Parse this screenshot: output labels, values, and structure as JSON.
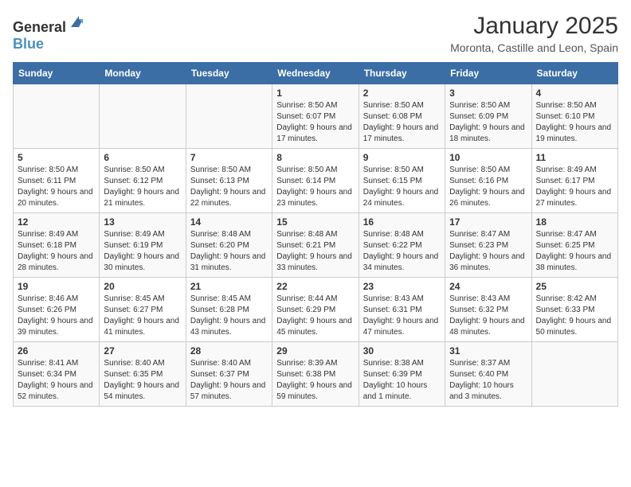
{
  "header": {
    "logo_general": "General",
    "logo_blue": "Blue",
    "month_year": "January 2025",
    "location": "Moronta, Castille and Leon, Spain"
  },
  "days_of_week": [
    "Sunday",
    "Monday",
    "Tuesday",
    "Wednesday",
    "Thursday",
    "Friday",
    "Saturday"
  ],
  "weeks": [
    [
      {
        "day": "",
        "info": ""
      },
      {
        "day": "",
        "info": ""
      },
      {
        "day": "",
        "info": ""
      },
      {
        "day": "1",
        "info": "Sunrise: 8:50 AM\nSunset: 6:07 PM\nDaylight: 9 hours and 17 minutes."
      },
      {
        "day": "2",
        "info": "Sunrise: 8:50 AM\nSunset: 6:08 PM\nDaylight: 9 hours and 17 minutes."
      },
      {
        "day": "3",
        "info": "Sunrise: 8:50 AM\nSunset: 6:09 PM\nDaylight: 9 hours and 18 minutes."
      },
      {
        "day": "4",
        "info": "Sunrise: 8:50 AM\nSunset: 6:10 PM\nDaylight: 9 hours and 19 minutes."
      }
    ],
    [
      {
        "day": "5",
        "info": "Sunrise: 8:50 AM\nSunset: 6:11 PM\nDaylight: 9 hours and 20 minutes."
      },
      {
        "day": "6",
        "info": "Sunrise: 8:50 AM\nSunset: 6:12 PM\nDaylight: 9 hours and 21 minutes."
      },
      {
        "day": "7",
        "info": "Sunrise: 8:50 AM\nSunset: 6:13 PM\nDaylight: 9 hours and 22 minutes."
      },
      {
        "day": "8",
        "info": "Sunrise: 8:50 AM\nSunset: 6:14 PM\nDaylight: 9 hours and 23 minutes."
      },
      {
        "day": "9",
        "info": "Sunrise: 8:50 AM\nSunset: 6:15 PM\nDaylight: 9 hours and 24 minutes."
      },
      {
        "day": "10",
        "info": "Sunrise: 8:50 AM\nSunset: 6:16 PM\nDaylight: 9 hours and 26 minutes."
      },
      {
        "day": "11",
        "info": "Sunrise: 8:49 AM\nSunset: 6:17 PM\nDaylight: 9 hours and 27 minutes."
      }
    ],
    [
      {
        "day": "12",
        "info": "Sunrise: 8:49 AM\nSunset: 6:18 PM\nDaylight: 9 hours and 28 minutes."
      },
      {
        "day": "13",
        "info": "Sunrise: 8:49 AM\nSunset: 6:19 PM\nDaylight: 9 hours and 30 minutes."
      },
      {
        "day": "14",
        "info": "Sunrise: 8:48 AM\nSunset: 6:20 PM\nDaylight: 9 hours and 31 minutes."
      },
      {
        "day": "15",
        "info": "Sunrise: 8:48 AM\nSunset: 6:21 PM\nDaylight: 9 hours and 33 minutes."
      },
      {
        "day": "16",
        "info": "Sunrise: 8:48 AM\nSunset: 6:22 PM\nDaylight: 9 hours and 34 minutes."
      },
      {
        "day": "17",
        "info": "Sunrise: 8:47 AM\nSunset: 6:23 PM\nDaylight: 9 hours and 36 minutes."
      },
      {
        "day": "18",
        "info": "Sunrise: 8:47 AM\nSunset: 6:25 PM\nDaylight: 9 hours and 38 minutes."
      }
    ],
    [
      {
        "day": "19",
        "info": "Sunrise: 8:46 AM\nSunset: 6:26 PM\nDaylight: 9 hours and 39 minutes."
      },
      {
        "day": "20",
        "info": "Sunrise: 8:45 AM\nSunset: 6:27 PM\nDaylight: 9 hours and 41 minutes."
      },
      {
        "day": "21",
        "info": "Sunrise: 8:45 AM\nSunset: 6:28 PM\nDaylight: 9 hours and 43 minutes."
      },
      {
        "day": "22",
        "info": "Sunrise: 8:44 AM\nSunset: 6:29 PM\nDaylight: 9 hours and 45 minutes."
      },
      {
        "day": "23",
        "info": "Sunrise: 8:43 AM\nSunset: 6:31 PM\nDaylight: 9 hours and 47 minutes."
      },
      {
        "day": "24",
        "info": "Sunrise: 8:43 AM\nSunset: 6:32 PM\nDaylight: 9 hours and 48 minutes."
      },
      {
        "day": "25",
        "info": "Sunrise: 8:42 AM\nSunset: 6:33 PM\nDaylight: 9 hours and 50 minutes."
      }
    ],
    [
      {
        "day": "26",
        "info": "Sunrise: 8:41 AM\nSunset: 6:34 PM\nDaylight: 9 hours and 52 minutes."
      },
      {
        "day": "27",
        "info": "Sunrise: 8:40 AM\nSunset: 6:35 PM\nDaylight: 9 hours and 54 minutes."
      },
      {
        "day": "28",
        "info": "Sunrise: 8:40 AM\nSunset: 6:37 PM\nDaylight: 9 hours and 57 minutes."
      },
      {
        "day": "29",
        "info": "Sunrise: 8:39 AM\nSunset: 6:38 PM\nDaylight: 9 hours and 59 minutes."
      },
      {
        "day": "30",
        "info": "Sunrise: 8:38 AM\nSunset: 6:39 PM\nDaylight: 10 hours and 1 minute."
      },
      {
        "day": "31",
        "info": "Sunrise: 8:37 AM\nSunset: 6:40 PM\nDaylight: 10 hours and 3 minutes."
      },
      {
        "day": "",
        "info": ""
      }
    ]
  ]
}
